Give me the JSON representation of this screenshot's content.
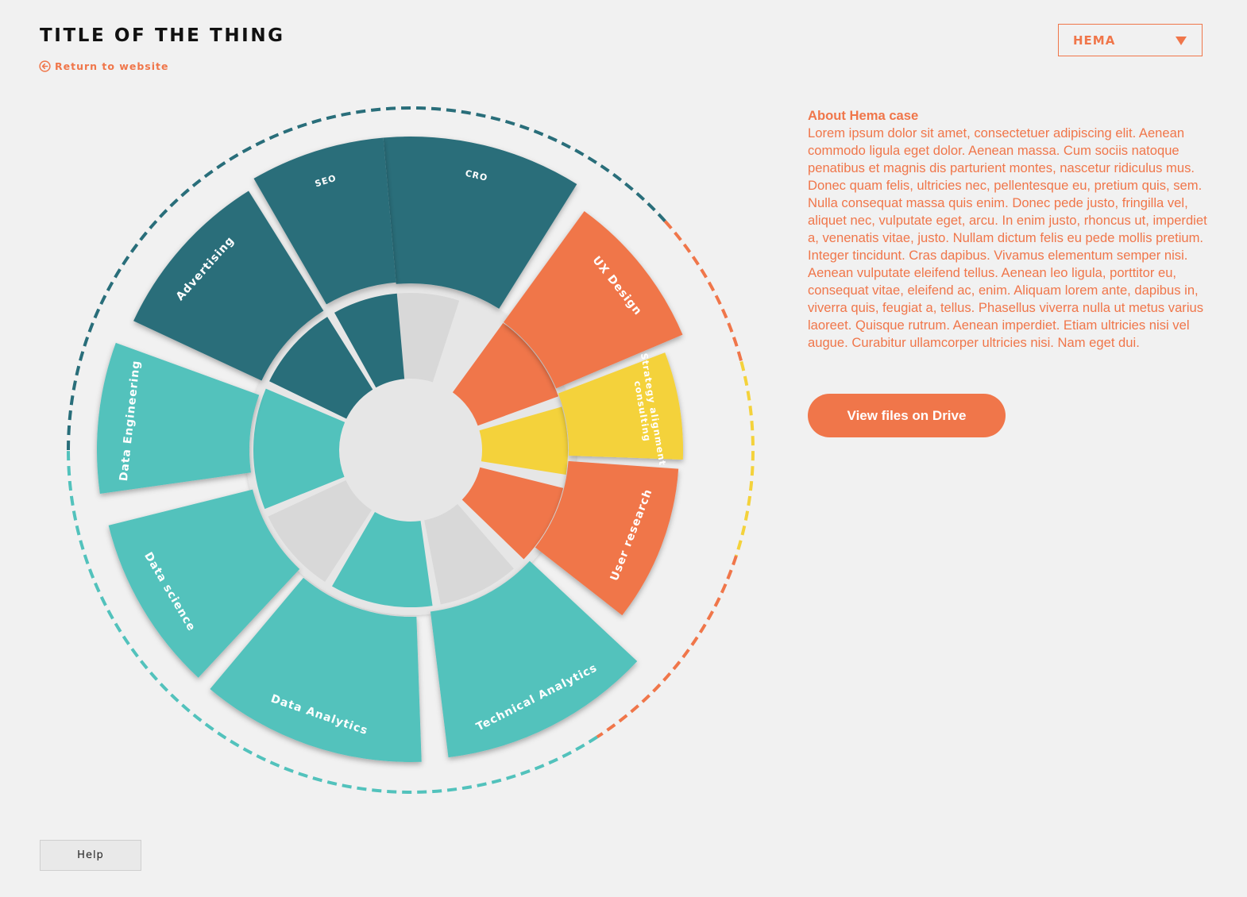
{
  "header": {
    "title": "TITLE OF THE THING",
    "back_link": "Return to website"
  },
  "case_select": {
    "value": "HEMA"
  },
  "about": {
    "heading": "About Hema case",
    "body": "Lorem ipsum dolor sit amet, consectetuer adipiscing elit. Aenean commodo ligula eget dolor. Aenean massa. Cum sociis natoque penatibus et magnis dis parturient montes, nascetur ridiculus mus. Donec quam felis, ultricies nec, pellentesque eu, pretium quis, sem. Nulla consequat massa quis enim. Donec pede justo, fringilla vel, aliquet nec, vulputate eget, arcu. In enim justo, rhoncus ut, imperdiet a, venenatis vitae, justo. Nullam dictum felis eu pede mollis pretium. Integer tincidunt. Cras dapibus. Vivamus elementum semper nisi. Aenean vulputate eleifend tellus. Aenean leo ligula, porttitor eu, consequat vitae, eleifend ac, enim. Aliquam lorem ante, dapibus in, viverra quis, feugiat a, tellus. Phasellus viverra nulla ut metus varius laoreet. Quisque rutrum. Aenean imperdiet. Etiam ultricies nisi vel augue. Curabitur ullamcorper ultricies nisi. Nam eget dui.",
    "button": "View files on Drive"
  },
  "help": {
    "label": "Help"
  },
  "colors": {
    "navy": "#296e7a",
    "orange": "#f0764a",
    "yellow": "#f4d23b",
    "teal": "#52c2bc",
    "grey": "#d8d8d8",
    "background": "#f1f1f1"
  },
  "wheel": {
    "segments": [
      {
        "label": "CRO",
        "group": "navy",
        "inner": "navy"
      },
      {
        "label": "UX Design",
        "group": "orange",
        "inner": "orange"
      },
      {
        "label": "Strategy alignment consulting",
        "group": "yellow",
        "inner": "yellow"
      },
      {
        "label": "User research",
        "group": "orange",
        "inner": "orange"
      },
      {
        "label": "Technical Analytics",
        "group": "teal",
        "inner": "grey"
      },
      {
        "label": "Data Analytics",
        "group": "teal",
        "inner": "teal"
      },
      {
        "label": "Data science",
        "group": "teal",
        "inner": "grey"
      },
      {
        "label": "Data Engineering",
        "group": "teal",
        "inner": "teal"
      },
      {
        "label": "Advertising",
        "group": "navy",
        "inner": "navy"
      },
      {
        "label": "SEO",
        "group": "navy",
        "inner": "navy"
      }
    ],
    "extra_inner": [
      {
        "inner": "grey"
      }
    ],
    "outer_ring_arcs": [
      {
        "color": "navy"
      },
      {
        "color": "orange"
      },
      {
        "color": "yellow"
      },
      {
        "color": "orange"
      },
      {
        "color": "teal"
      }
    ]
  }
}
